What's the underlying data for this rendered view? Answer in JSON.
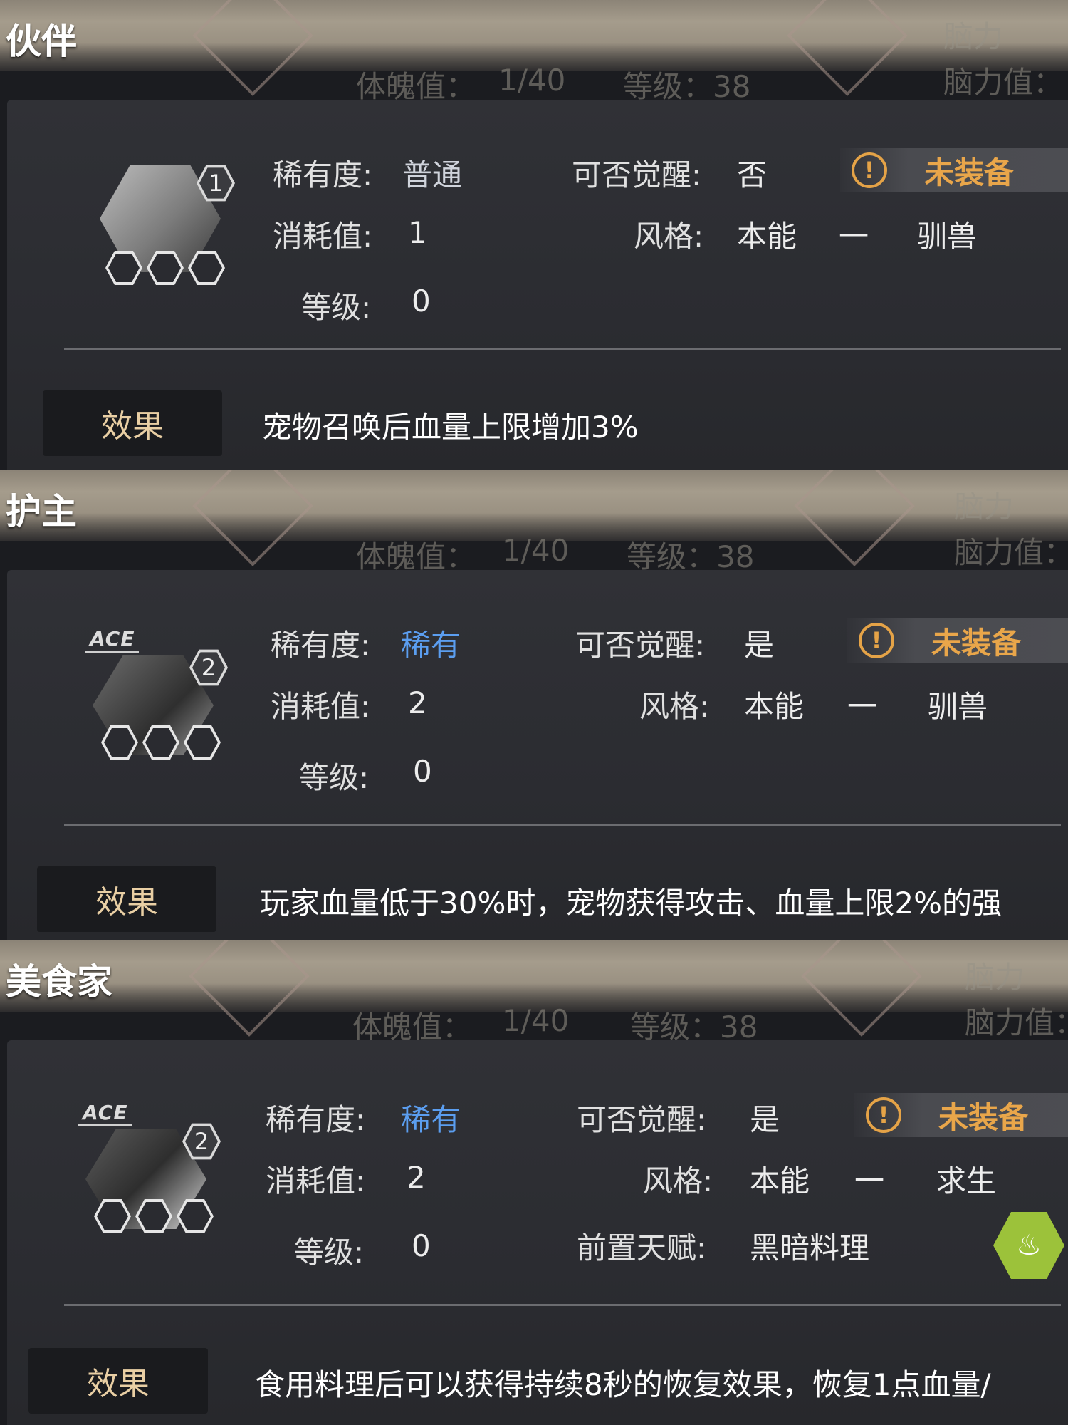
{
  "cards": [
    {
      "title": "伙伴",
      "level_badge": "1",
      "has_ace": false,
      "rarity_label": "稀有度:",
      "rarity_value": "普通",
      "cost_label": "消耗值:",
      "cost_value": "1",
      "level_label": "等级:",
      "level_value": "0",
      "awaken_label": "可否觉醒:",
      "awaken_value": "否",
      "equip_status": "未装备",
      "style_label": "风格:",
      "style_main": "本能",
      "style_dash": "一",
      "style_sub": "驯兽",
      "effect_label": "效果",
      "effect_text": "宠物召唤后血量上限增加3%"
    },
    {
      "title": "护主",
      "level_badge": "2",
      "has_ace": true,
      "ace_text": "ACE",
      "rarity_label": "稀有度:",
      "rarity_value": "稀有",
      "cost_label": "消耗值:",
      "cost_value": "2",
      "level_label": "等级:",
      "level_value": "0",
      "awaken_label": "可否觉醒:",
      "awaken_value": "是",
      "equip_status": "未装备",
      "style_label": "风格:",
      "style_main": "本能",
      "style_dash": "一",
      "style_sub": "驯兽",
      "effect_label": "效果",
      "effect_text": "玩家血量低于30%时，宠物获得攻击、血量上限2%的强"
    },
    {
      "title": "美食家",
      "level_badge": "2",
      "has_ace": true,
      "ace_text": "ACE",
      "rarity_label": "稀有度:",
      "rarity_value": "稀有",
      "cost_label": "消耗值:",
      "cost_value": "2",
      "level_label": "等级:",
      "level_value": "0",
      "awaken_label": "可否觉醒:",
      "awaken_value": "是",
      "equip_status": "未装备",
      "style_label": "风格:",
      "style_main": "本能",
      "style_dash": "一",
      "style_sub": "求生",
      "pre_talent_label": "前置天赋:",
      "pre_talent_value": "黑暗料理",
      "effect_label": "效果",
      "effect_text": "食用料理后可以获得持续8秒的恢复效果，恢复1点血量/"
    }
  ],
  "background_ghost": {
    "stat1": "体魄值：",
    "stat1_val": "1/40",
    "grade": "等级：38",
    "brain": "脑力",
    "brain_val": "脑力值："
  },
  "colors": {
    "rare": "#5b9ef0",
    "common": "#d0d4dc",
    "equip": "#e9a64a",
    "effect_label": "#e9cfa4"
  }
}
